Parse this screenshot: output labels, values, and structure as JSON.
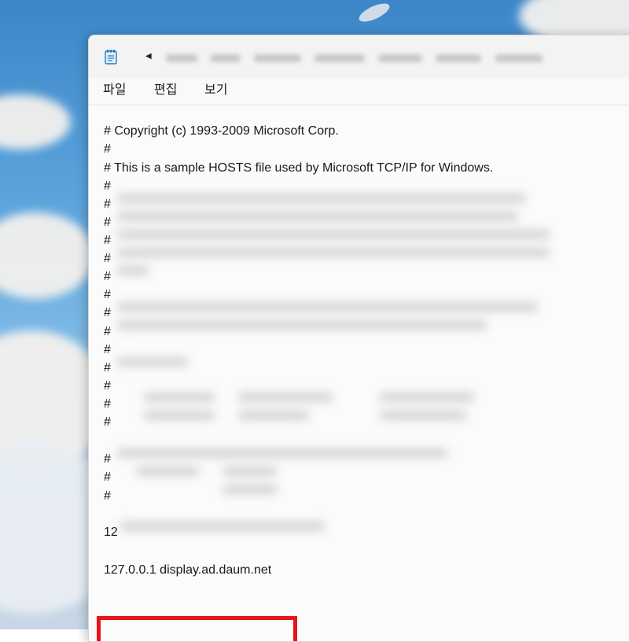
{
  "menu": {
    "file": "파일",
    "edit": "편집",
    "view": "보기"
  },
  "titlebar": {
    "app_icon": "notepad-icon",
    "back_icon": "chevron-left-icon",
    "back_glyph": "◀"
  },
  "editor": {
    "copyright_line": "# Copyright (c) 1993-2009 Microsoft Corp.",
    "hash": "#",
    "sample_line": "# This is a sample HOSTS file used by Microsoft TCP/IP for Windows.",
    "partial_entry_prefix": "12",
    "highlighted_entry": "127.0.0.1 display.ad.daum.net"
  },
  "colors": {
    "highlight": "#e8141c",
    "window_bg": "#f9f9f9"
  }
}
